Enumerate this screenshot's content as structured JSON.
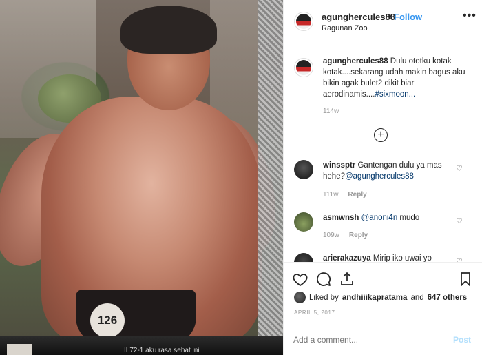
{
  "photo": {
    "bib_number": "126",
    "strip_text": "II 72-1 aku rasa sehat ini"
  },
  "header": {
    "username": "agunghercules88",
    "dot": "•",
    "follow_label": "Follow",
    "location": "Ragunan Zoo",
    "more_icon": "more-horizontal-icon"
  },
  "caption": {
    "username": "agunghercules88",
    "text": " Dulu ototku kotak kotak....sekarang udah makin bagus aku bikin agak bulet2 dikit biar aerodinamis....",
    "hashtag": "#sixmoon...",
    "age": "114w"
  },
  "load_more_icon": "plus-circle-icon",
  "comments": [
    {
      "username": "winssptr",
      "text": " Gantengan dulu ya mas hehe?",
      "mention": "@agunghercules88",
      "age": "111w",
      "reply_label": "Reply"
    },
    {
      "username": "asmwnsh",
      "text": " ",
      "mention": "@anoni4n",
      "text_after": " mudo",
      "age": "109w",
      "reply_label": "Reply"
    },
    {
      "username": "arierakazuya",
      "text": " Mirip iko uwai yo",
      "age": "",
      "reply_label": ""
    }
  ],
  "actions": {
    "like_icon": "heart-icon",
    "comment_icon": "comment-icon",
    "share_icon": "share-icon",
    "save_icon": "bookmark-icon",
    "liked_by_prefix": "Liked by",
    "liked_by_user": "andhiiikapratama",
    "and_label": "and",
    "others": "647 others",
    "date": "APRIL 5, 2017"
  },
  "add_comment": {
    "placeholder": "Add a comment...",
    "post_label": "Post"
  },
  "colors": {
    "link": "#003569",
    "follow": "#3897f0",
    "post_disabled": "#b2dffc",
    "muted": "#999999",
    "text": "#262626"
  }
}
